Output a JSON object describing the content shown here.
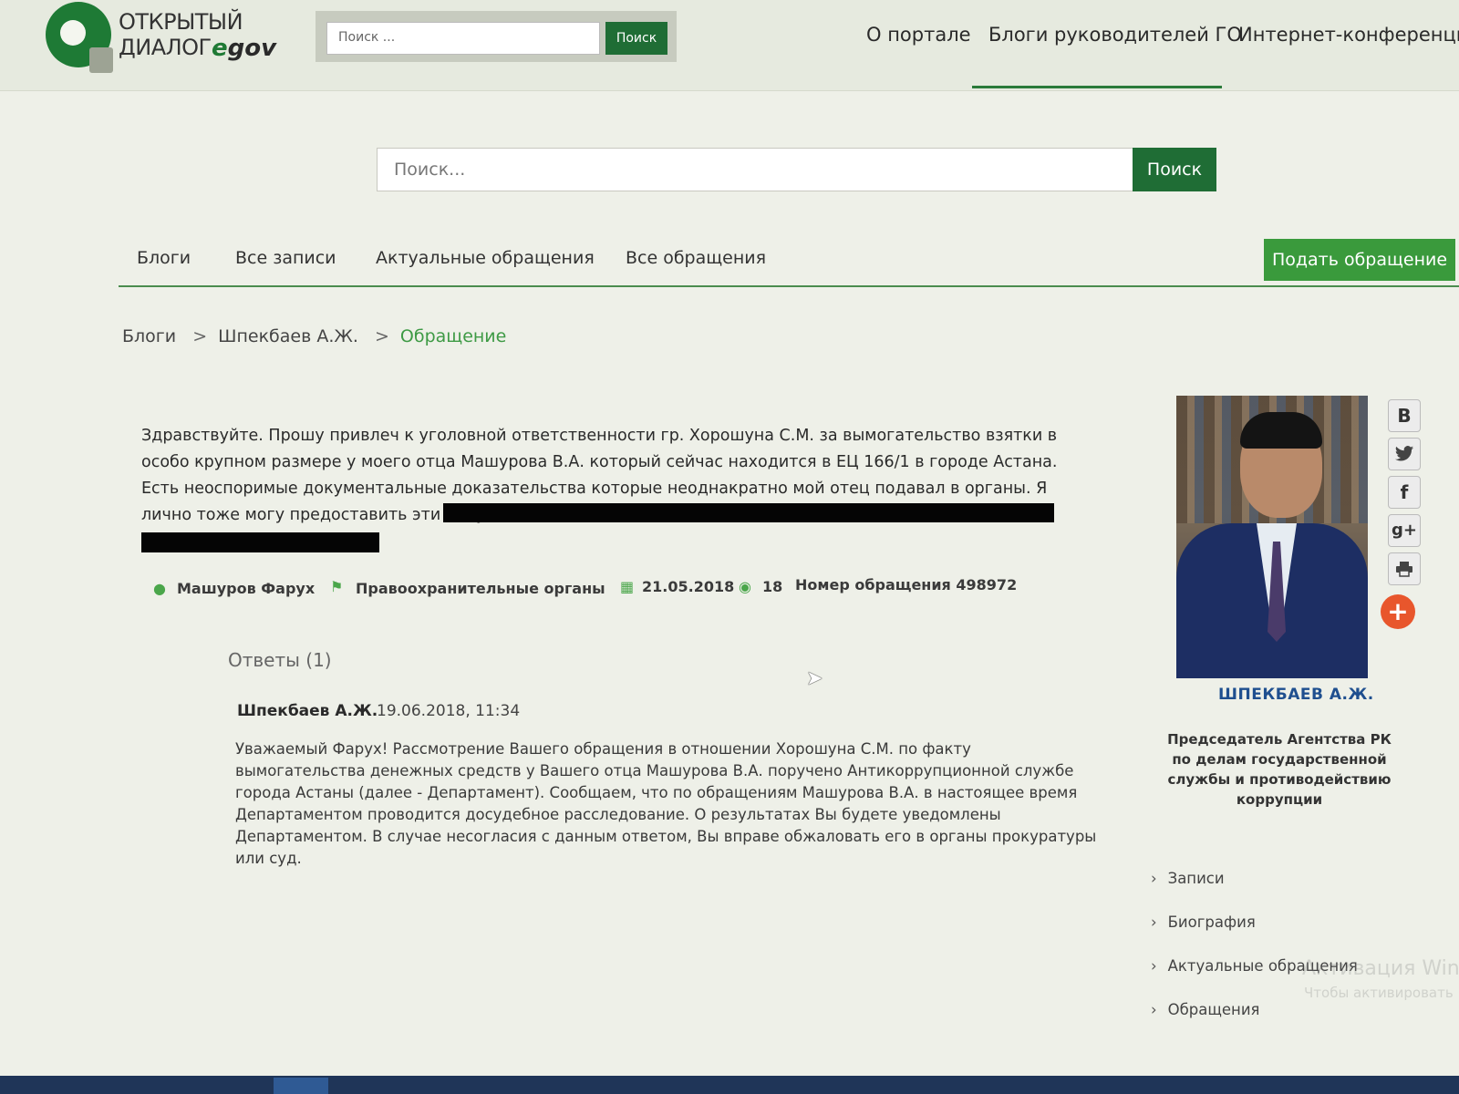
{
  "header": {
    "logo": {
      "line1": "ОТКРЫТЫЙ",
      "line2": "ДИАЛОГ",
      "egov_e": "e",
      "egov_gov": "gov"
    },
    "search": {
      "placeholder": "Поиск ...",
      "button": "Поиск"
    },
    "nav": [
      {
        "label": "О портале"
      },
      {
        "label": "Блоги руководителей ГО"
      },
      {
        "label": "Интернет-конференции"
      }
    ]
  },
  "main_search": {
    "placeholder": "Поиск...",
    "button": "Поиск"
  },
  "subnav": {
    "items": [
      {
        "label": "Блоги"
      },
      {
        "label": "Все записи"
      },
      {
        "label": "Актуальные обращения"
      },
      {
        "label": "Все обращения"
      }
    ],
    "submit_button": "Подать обращение"
  },
  "breadcrumb": {
    "items": [
      "Блоги",
      "Шпекбаев А.Ж."
    ],
    "separator": ">",
    "current": "Обращение"
  },
  "appeal": {
    "text": "Здравствуйте. Прошу привлеч к уголовной ответственности гр. Хорошуна С.М. за вымогательство взятки в особо крупном размере у моего отца Машурова В.А. который сейчас находится в ЕЦ 166/1 в городе Астана. Есть неоспоримые документальные доказательства которые неоднакратно мой отец подавал в органы. Я лично тоже могу предоставить эти документы.",
    "author": "Машуров Фарух",
    "category": "Правоохранительные органы",
    "date": "21.05.2018",
    "views": "18",
    "number_label": "Номер обращения 498972"
  },
  "answers": {
    "title": "Ответы (1)",
    "items": [
      {
        "author": "Шпекбаев А.Ж.",
        "date": "19.06.2018, 11:34",
        "text": "Уважаемый Фарух! Рассмотрение Вашего обращения в отношении Хорошуна С.М. по факту вымогательства денежных средств у Вашего отца Машурова В.А. поручено Антикоррупционной службе города Астаны (далее - Департамент). Сообщаем, что по обращениям Машурова В.А. в настоящее время Департаментом проводится досудебное расследование. О результатах Вы будете уведомлены Департаментом. В случае несогласия с данным ответом, Вы вправе обжаловать его в органы прокуратуры или суд."
      }
    ]
  },
  "sidebar": {
    "leader_name": "ШПЕКБАЕВ А.Ж.",
    "leader_role": "Председатель Агентства РК по делам государственной службы и противодействию коррупции",
    "social": [
      "В",
      "twitter-icon",
      "f",
      "g+",
      "print-icon",
      "+"
    ],
    "links": [
      {
        "label": "Записи"
      },
      {
        "label": "Биография"
      },
      {
        "label": "Актуальные обращения"
      },
      {
        "label": "Обращения"
      }
    ]
  },
  "overlay": {
    "watermark": "Активация Wind",
    "watermark_sub": "Чтобы активировать"
  },
  "colors": {
    "brand_green": "#1f6d35",
    "accent_green": "#3a9a3c",
    "link_blue": "#1f4f8f",
    "plus_orange": "#e8562c"
  }
}
